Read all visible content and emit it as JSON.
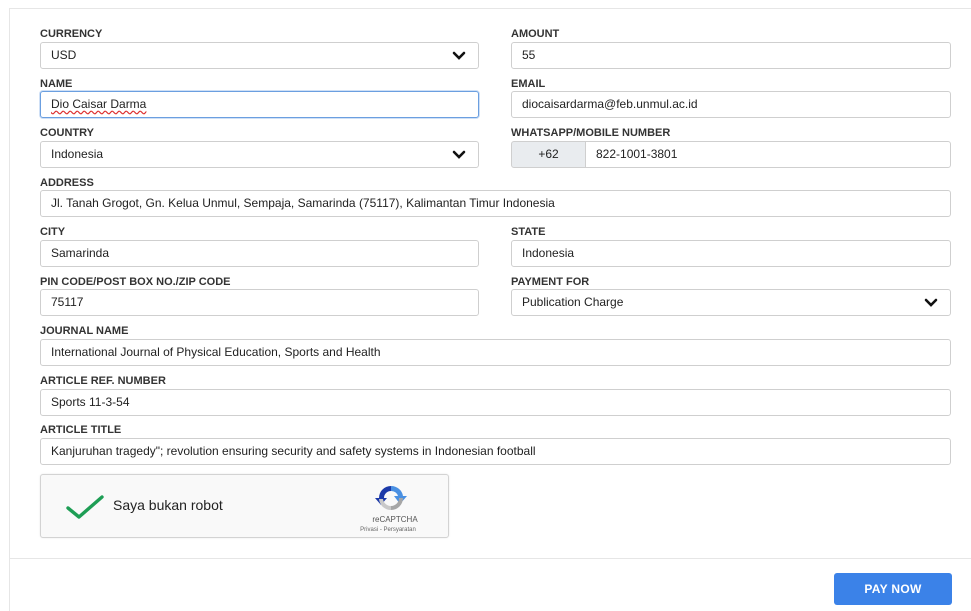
{
  "form": {
    "currency": {
      "label": "CURRENCY",
      "value": "USD"
    },
    "amount": {
      "label": "AMOUNT",
      "value": "55"
    },
    "name": {
      "label": "NAME",
      "value": "Dio Caisar Darma"
    },
    "email": {
      "label": "EMAIL",
      "value": "diocaisardarma@feb.unmul.ac.id"
    },
    "country": {
      "label": "COUNTRY",
      "value": "Indonesia"
    },
    "phone": {
      "label": "WHATSAPP/MOBILE NUMBER",
      "prefix": "+62",
      "value": "822-1001-3801"
    },
    "address": {
      "label": "ADDRESS",
      "value": "Jl. Tanah Grogot, Gn. Kelua Unmul, Sempaja, Samarinda (75117), Kalimantan Timur Indonesia"
    },
    "city": {
      "label": "CITY",
      "value": "Samarinda"
    },
    "state": {
      "label": "STATE",
      "value": "Indonesia"
    },
    "pin": {
      "label": "PIN CODE/POST BOX NO./ZIP CODE",
      "value": "75117"
    },
    "payment_for": {
      "label": "PAYMENT FOR",
      "value": "Publication Charge"
    },
    "journal": {
      "label": "JOURNAL NAME",
      "value": "International Journal of Physical Education, Sports and Health"
    },
    "article_ref": {
      "label": "ARTICLE REF. NUMBER",
      "value": "Sports 11-3-54"
    },
    "article_title": {
      "label": "ARTICLE TITLE",
      "value": "Kanjuruhan tragedy\"; revolution ensuring security and safety systems in Indonesian football"
    }
  },
  "captcha": {
    "label": "Saya bukan robot",
    "brand": "reCAPTCHA",
    "links": "Privasi - Persyaratan",
    "check_color": "#1e9e55"
  },
  "actions": {
    "pay_label": "PAY NOW"
  },
  "colors": {
    "accent": "#3b82e8",
    "focus_border": "#6b9fe0"
  }
}
